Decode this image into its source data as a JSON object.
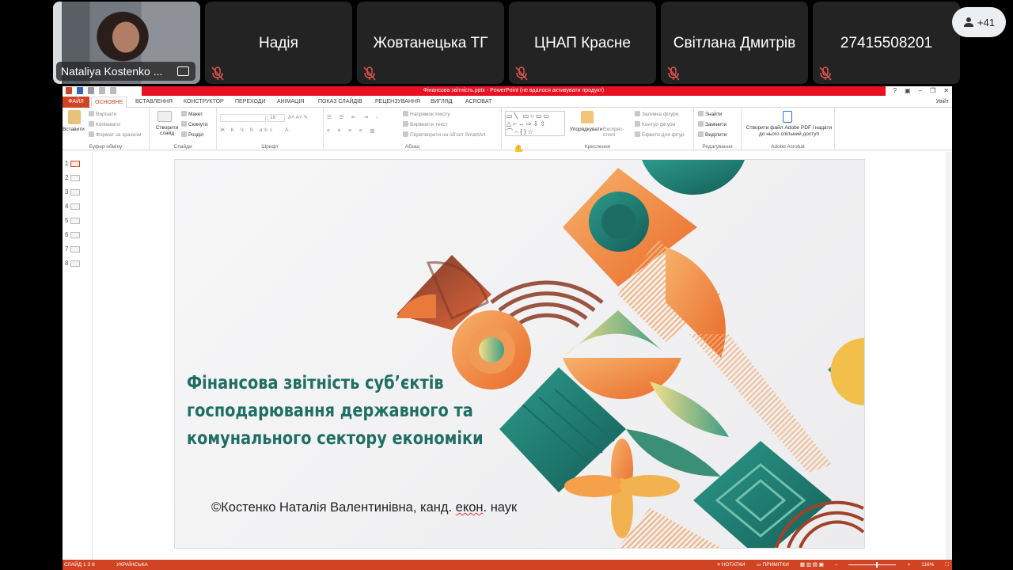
{
  "participants": [
    {
      "name": "Nataliya Kostenko ...",
      "video": true
    },
    {
      "name": "Надія"
    },
    {
      "name": "Жовтанецька ТГ"
    },
    {
      "name": "ЦНАП Красне"
    },
    {
      "name": "Світлана Дмитрів"
    },
    {
      "name": "27415508201"
    }
  ],
  "participant_count_badge": "+41",
  "ppt": {
    "window_title": "Фінансова звітність.pptx - PowerPoint (не вдалося активувати продукт)",
    "tabs": [
      "ФАЙЛ",
      "ОСНОВНЕ",
      "ВСТАВЛЕННЯ",
      "КОНСТРУКТОР",
      "ПЕРЕХОДИ",
      "АНІМАЦІЯ",
      "ПОКАЗ СЛАЙДІВ",
      "РЕЦЕНЗУВАННЯ",
      "ВИГЛЯД",
      "ACROBAT"
    ],
    "signin": "Увійт",
    "ribbon": {
      "clipboard": {
        "paste": "Вставити",
        "cut": "Вирізати",
        "copy": "Копіювати",
        "format": "Формат за зразком",
        "group": "Буфер обміну"
      },
      "slides": {
        "new": "Створити слайд",
        "layout": "Макет",
        "reset": "Скинути",
        "section": "Розділ",
        "group": "Слайди"
      },
      "font": {
        "size": "18",
        "group": "Шрифт",
        "buttons": "Ж К Ч S abc"
      },
      "paragraph": {
        "direction": "Напрямок тексту",
        "align": "Вирівняти текст",
        "smartart": "Перетворити на об'єкт SmartArt",
        "group": "Абзац"
      },
      "drawing": {
        "arrange": "Упорядкувати",
        "quickstyles": "Експрес-стилі",
        "fill": "Заливка фігури",
        "outline": "Контур фігури",
        "effects": "Ефекти для фігур",
        "group": "Креслення"
      },
      "editing": {
        "find": "Знайти",
        "replace": "Замінити",
        "select": "Виділити",
        "group": "Редагування"
      },
      "acrobat": {
        "create": "Створити файл Adobe PDF і надати до нього спільний доступ",
        "group": "Adobe Acrobat"
      }
    },
    "thumbnails": [
      "1",
      "2",
      "3",
      "4",
      "5",
      "6",
      "7",
      "8"
    ],
    "slide": {
      "title_lines": [
        "Фінансова звітність суб’єктів",
        "господарювання державного та",
        "комунального сектору економіки"
      ],
      "author_pre": "©Костенко Наталія Валентинівна, канд. ",
      "author_sq": "екон",
      "author_post": ". наук"
    },
    "status": {
      "slide": "СЛАЙД 1 З 8",
      "language": "УКРАЇНСЬКА",
      "notes": "НОТАТКИ",
      "comments": "ПРИМІТКИ",
      "zoom": "116%"
    }
  },
  "colors": {
    "accent": "#d04423",
    "title_teal": "#1f6e63",
    "orange": "#f08a3c",
    "teal": "#1e7a70"
  }
}
